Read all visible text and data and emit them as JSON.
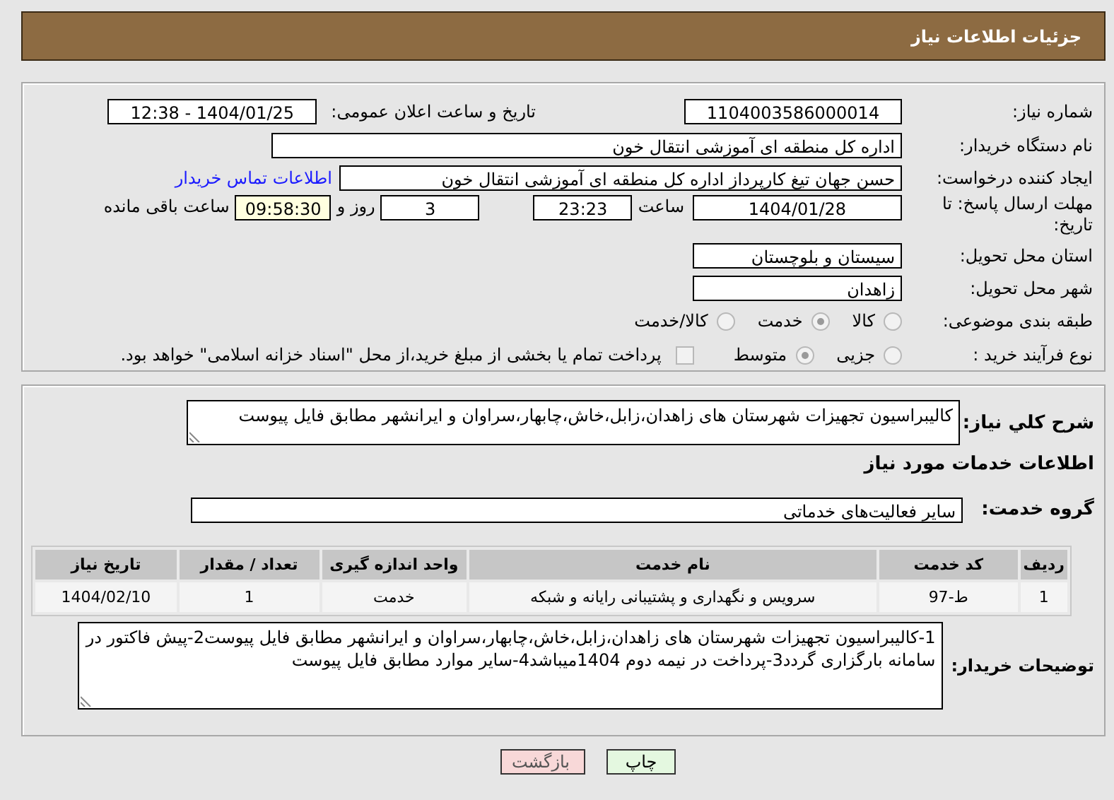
{
  "title": "جزئیات اطلاعات نیاز",
  "need_number": {
    "label": "شماره نیاز:",
    "value": "1104003586000014"
  },
  "announce": {
    "label": "تاریخ و ساعت اعلان عمومی:",
    "value": "1404/01/25 - 12:38"
  },
  "buyer_org": {
    "label": "نام دستگاه خریدار:",
    "value": "اداره کل منطقه ای آموزشی انتقال خون"
  },
  "requester": {
    "label": "ایجاد کننده درخواست:",
    "value": "حسن جهان تیغ کارپرداز اداره کل منطقه ای آموزشی انتقال خون",
    "link": "اطلاعات تماس خریدار"
  },
  "deadline": {
    "label": "مهلت ارسال پاسخ: تا تاریخ:",
    "date": "1404/01/28",
    "time_label": "ساعت",
    "time": "23:23",
    "days": "3",
    "days_label": "روز و",
    "remaining": "09:58:30",
    "remaining_label": "ساعت باقی مانده"
  },
  "province": {
    "label": "استان محل تحویل:",
    "value": "سیستان و بلوچستان"
  },
  "city": {
    "label": "شهر محل تحویل:",
    "value": "زاهدان"
  },
  "category": {
    "label": "طبقه بندی موضوعی:",
    "options": [
      {
        "label": "کالا",
        "selected": false
      },
      {
        "label": "خدمت",
        "selected": true
      },
      {
        "label": "کالا/خدمت",
        "selected": false
      }
    ]
  },
  "process": {
    "label": "نوع فرآیند خرید :",
    "options": [
      {
        "label": "جزیی",
        "selected": false
      },
      {
        "label": "متوسط",
        "selected": true
      }
    ],
    "payment": {
      "label": "پرداخت تمام یا بخشی از مبلغ خرید،از محل \"اسناد خزانه اسلامی\" خواهد بود.",
      "checked": false
    }
  },
  "description": {
    "label": "شرح کلي نیاز:",
    "value": "کالیبراسیون تجهیزات شهرستان های زاهدان،زابل،خاش،چابهار،سراوان و ایرانشهر مطابق فایل پیوست"
  },
  "services_heading": "اطلاعات خدمات مورد نیاز",
  "service_group": {
    "label": "گروه خدمت:",
    "value": "سایر فعالیت‌های خدماتی"
  },
  "table": {
    "columns": [
      "ردیف",
      "کد خدمت",
      "نام خدمت",
      "واحد اندازه گیری",
      "تعداد / مقدار",
      "تاریخ نیاز"
    ],
    "rows": [
      [
        "1",
        "ط-97",
        "سرویس و نگهداری و پشتیبانی رایانه و شبکه",
        "خدمت",
        "1",
        "1404/02/10"
      ]
    ]
  },
  "buyer_notes": {
    "label": "توضیحات خریدار:",
    "value": "1-کالیبراسیون تجهیزات شهرستان های زاهدان،زابل،خاش،چابهار،سراوان و ایرانشهر مطابق فایل  پیوست2-پیش فاکتور در سامانه بارگزاری گردد3-پرداخت در نیمه دوم 1404میباشد4-سایر موارد مطابق فایل پیوست"
  },
  "buttons": [
    {
      "label": "چاپ",
      "kind": "print"
    },
    {
      "label": "بازگشت",
      "kind": "back"
    }
  ]
}
